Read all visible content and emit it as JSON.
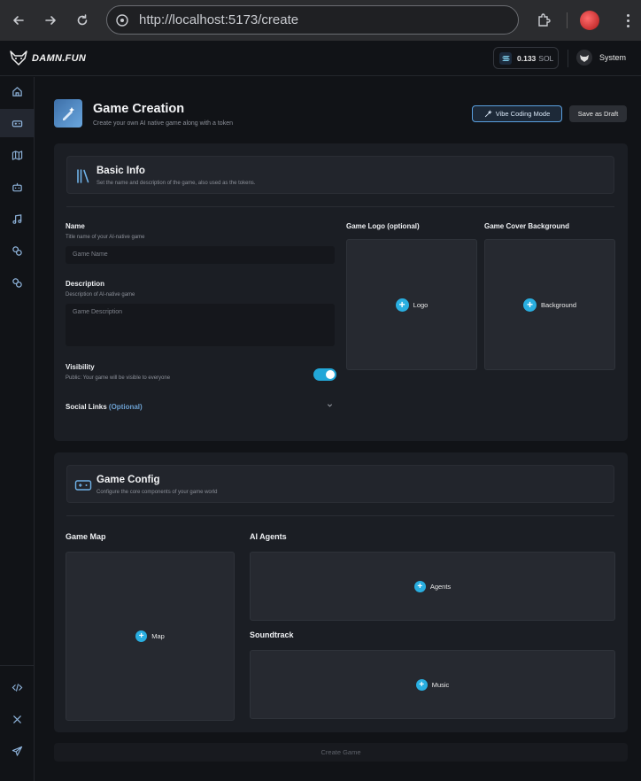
{
  "browser": {
    "url": "http://localhost:5173/create"
  },
  "topbar": {
    "logo_text": "DAMN.FUN",
    "balance_amount": "0.133",
    "balance_unit": "SOL",
    "user_name": "System"
  },
  "header": {
    "title": "Game Creation",
    "subtitle": "Create your own AI native game along with a token",
    "vibe_button": "Vibe Coding Mode",
    "draft_button": "Save as Draft"
  },
  "basic_info": {
    "title": "Basic Info",
    "subtitle": "Set the name and description of the game, also used as the tokens.",
    "name_label": "Name",
    "name_hint": "Title name of your AI-native game",
    "name_placeholder": "Game Name",
    "desc_label": "Description",
    "desc_hint": "Description of AI-native game",
    "desc_placeholder": "Game Description",
    "visibility_label": "Visibility",
    "visibility_hint": "Public: Your game will be visible to everyone",
    "visibility_on": true,
    "social_label": "Social Links",
    "social_optional": "(Optional)",
    "logo_label": "Game Logo (optional)",
    "logo_button": "Logo",
    "cover_label": "Game Cover Background",
    "cover_button": "Background"
  },
  "game_config": {
    "title": "Game Config",
    "subtitle": "Configure the core components of your game world",
    "map_label": "Game Map",
    "map_button": "Map",
    "agents_label": "AI Agents",
    "agents_button": "Agents",
    "soundtrack_label": "Soundtrack",
    "soundtrack_button": "Music"
  },
  "footer": {
    "create_button": "Create Game"
  },
  "colors": {
    "accent": "#29aee0",
    "background": "#111317",
    "panel": "#1b1e24"
  },
  "sidebar_icons": [
    "home-icon",
    "gamepad-icon",
    "map-icon",
    "bot-icon",
    "music-icon",
    "link-icon",
    "link-icon",
    "code-icon",
    "x-icon",
    "send-icon"
  ]
}
